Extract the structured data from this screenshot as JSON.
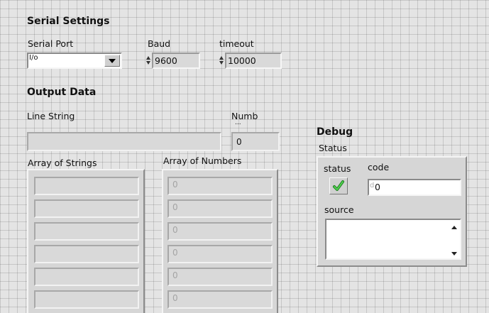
{
  "serial_settings": {
    "title": "Serial Settings",
    "serial_port": {
      "label": "Serial Port",
      "glyph": "I/o",
      "value": ""
    },
    "baud": {
      "label": "Baud",
      "value": "9600"
    },
    "timeout": {
      "label": "timeout",
      "value": "10000"
    }
  },
  "output_data": {
    "title": "Output Data",
    "line_string": {
      "label": "Line String",
      "value": ""
    },
    "number": {
      "label": "Numb",
      "label_cont": "...",
      "value": "0"
    },
    "array_of_strings": {
      "label": "Array of Strings",
      "items": [
        "",
        "",
        "",
        "",
        "",
        ""
      ]
    },
    "array_of_numbers": {
      "label": "Array of Numbers",
      "items": [
        "0",
        "0",
        "0",
        "0",
        "0",
        "0"
      ]
    }
  },
  "debug": {
    "title": "Debug",
    "status_cluster": {
      "label": "Status",
      "status_label": "status",
      "status_ok": true,
      "code_label": "code",
      "code_prefix": "d",
      "code_value": "0",
      "source_label": "source",
      "source_value": ""
    }
  },
  "colors": {
    "panel_bg": "#e4e4e4",
    "grid_line": "#c8c8c8",
    "indicator_bg": "#d9d9d9",
    "check_green": "#2e9d2e"
  },
  "icons": {
    "dropdown": "down-arrow-icon",
    "spin": "increment-decrement-icon",
    "check": "checkmark-icon",
    "scroll_up": "up-arrow-icon",
    "scroll_down": "down-arrow-icon"
  }
}
